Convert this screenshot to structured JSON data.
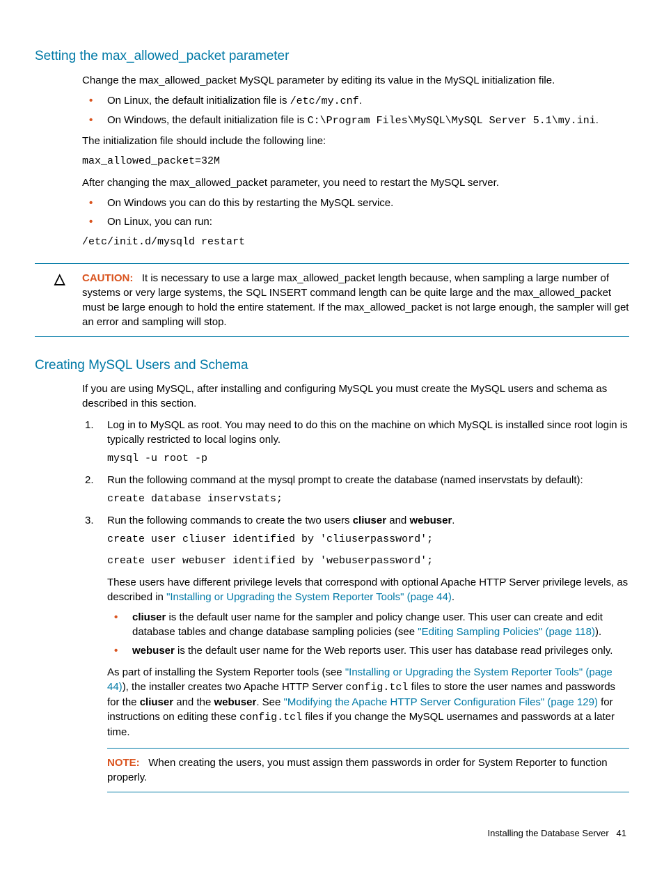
{
  "section1": {
    "heading": "Setting the max_allowed_packet parameter",
    "intro": "Change the max_allowed_packet MySQL parameter by editing its value in the MySQL initialization file.",
    "bullet1_pre": "On Linux, the default initialization file is ",
    "bullet1_code": "/etc/my.cnf",
    "bullet1_post": ".",
    "bullet2_pre": "On Windows, the default initialization file is ",
    "bullet2_code": "C:\\Program Files\\MySQL\\MySQL Server 5.1\\my.ini",
    "bullet2_post": ".",
    "line_intro": "The initialization file should include the following line:",
    "code1": "max_allowed_packet=32M",
    "after": "After changing the max_allowed_packet parameter, you need to restart the MySQL server.",
    "bullet3": "On Windows you can do this by restarting the MySQL service.",
    "bullet4": "On Linux, you can run:",
    "code2": "/etc/init.d/mysqld restart"
  },
  "caution": {
    "label": "CAUTION:",
    "text": "It is necessary to use a large max_allowed_packet length because, when sampling a large number of systems or very large systems, the SQL INSERT command length can be quite large and the max_allowed_packet must be large enough to hold the entire statement. If the max_allowed_packet is not large enough, the sampler will get an error and sampling will stop."
  },
  "section2": {
    "heading": "Creating MySQL Users and Schema",
    "intro": "If you are using MySQL, after installing and configuring MySQL you must create the MySQL users and schema as described in this section.",
    "step1": "Log in to MySQL as root. You may need to do this on the machine on which MySQL is installed since root login is typically restricted to local logins only.",
    "step1_code": "mysql -u root -p",
    "step2": "Run the following command at the mysql prompt to create the database (named inservstats by default):",
    "step2_code": "create database inservstats;",
    "step3_pre": "Run the following commands to create the two users ",
    "step3_b1": "cliuser",
    "step3_mid": " and ",
    "step3_b2": "webuser",
    "step3_post": ".",
    "step3_code1": "create user cliuser identified by 'cliuserpassword';",
    "step3_code2": "create user webuser identified by 'webuserpassword';",
    "priv_pre": "These users have different privilege levels that correspond with optional Apache HTTP Server privilege levels, as described in ",
    "priv_link": "\"Installing or Upgrading the System Reporter Tools\" (page 44)",
    "priv_post": ".",
    "sub1_b": "cliuser",
    "sub1_text": " is the default user name for the sampler and policy change user. This user can create and edit database tables and change database sampling policies (see ",
    "sub1_link": "\"Editing Sampling Policies\" (page 118)",
    "sub1_post": ").",
    "sub2_b": "webuser",
    "sub2_text": " is the default user name for the Web reports user. This user has database read privileges only.",
    "install_pre": "As part of installing the System Reporter tools (see ",
    "install_link1": "\"Installing or Upgrading the System Reporter Tools\" (page 44)",
    "install_mid1": "), the installer creates two Apache HTTP Server ",
    "install_code1": "config.tcl",
    "install_mid2": " files to store the user names and passwords for the ",
    "install_b1": "cliuser",
    "install_mid3": " and the ",
    "install_b2": "webuser",
    "install_mid4": ". See ",
    "install_link2": "\"Modifying the Apache HTTP Server Configuration Files\" (page 129)",
    "install_mid5": " for instructions on editing these ",
    "install_code2": "config.tcl",
    "install_post": " files if you change the MySQL usernames and passwords at a later time.",
    "note_label": "NOTE:",
    "note_text": "When creating the users, you must assign them passwords in order for System Reporter to function properly."
  },
  "footer": {
    "title": "Installing the Database Server",
    "page": "41"
  }
}
